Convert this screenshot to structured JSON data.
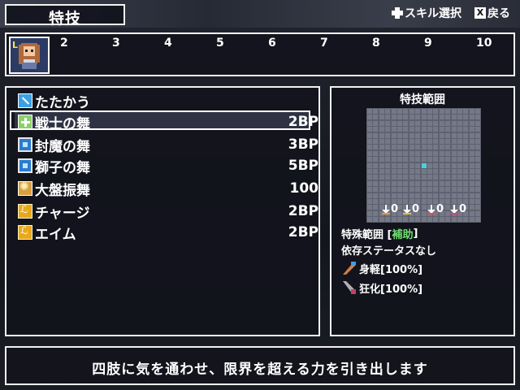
{
  "header": {
    "title": "特技",
    "help_select": "スキル選択",
    "help_back": "戻る"
  },
  "party": {
    "leader_level_label": "L",
    "slots": [
      "2",
      "3",
      "4",
      "5",
      "6",
      "7",
      "8",
      "9",
      "10"
    ]
  },
  "skills": [
    {
      "name": "たたかう",
      "cost": "",
      "icon": "attack-icon"
    },
    {
      "name": "戦士の舞",
      "cost": "2BP",
      "icon": "heal-plus-icon",
      "selected": true
    },
    {
      "name": "封魔の舞",
      "cost": "3BP",
      "icon": "dance-icon"
    },
    {
      "name": "獅子の舞",
      "cost": "5BP",
      "icon": "dance-icon"
    },
    {
      "name": "大盤振舞",
      "cost": "100",
      "icon": "burst-icon"
    },
    {
      "name": "チャージ",
      "cost": "2BP",
      "icon": "buff-icon"
    },
    {
      "name": "エイム",
      "cost": "2BP",
      "icon": "buff-icon"
    }
  ],
  "range_panel": {
    "title": "特技範囲",
    "grid_size": 19,
    "center_cell": [
      9,
      9
    ],
    "resist_values": [
      "0",
      "0",
      "0",
      "0"
    ],
    "special_label": "特殊範囲 [",
    "special_value": "補助",
    "special_close": "]",
    "dependency": "依存ステータスなし",
    "states": [
      {
        "name": "身軽[100%]",
        "icon": "agility-icon"
      },
      {
        "name": "狂化[100%]",
        "icon": "berserk-icon"
      }
    ]
  },
  "description": "四肢に気を通わせ、限界を超える力を引き出します",
  "colors": {
    "border": "#f2f2f2",
    "grid": "#5e6270",
    "center_cell": "#4ecfd8",
    "accent_green": "#6fe06f"
  }
}
